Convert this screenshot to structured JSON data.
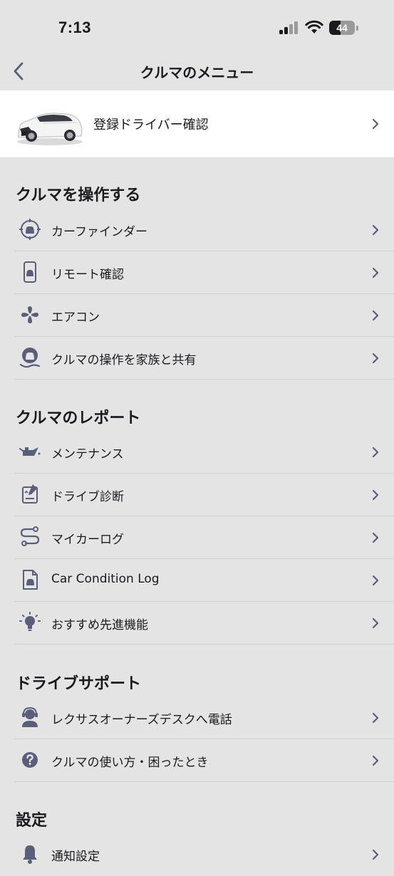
{
  "status_bar": {
    "time": "7:13",
    "battery_level": "44",
    "battery_fraction": 0.44
  },
  "nav": {
    "title": "クルマのメニュー"
  },
  "vehicle": {
    "label": "登録ドライバー確認"
  },
  "sections": {
    "operate": {
      "title": "クルマを操作する",
      "items": [
        {
          "label": "カーファインダー",
          "icon": "car-finder-icon"
        },
        {
          "label": "リモート確認",
          "icon": "remote-check-icon"
        },
        {
          "label": "エアコン",
          "icon": "fan-icon"
        },
        {
          "label": "クルマの操作を家族と共有",
          "icon": "share-car-icon"
        }
      ]
    },
    "report": {
      "title": "クルマのレポート",
      "items": [
        {
          "label": "メンテナンス",
          "icon": "oil-can-icon"
        },
        {
          "label": "ドライブ診断",
          "icon": "drive-diagnosis-icon"
        },
        {
          "label": "マイカーログ",
          "icon": "route-icon"
        },
        {
          "label": "Car Condition Log",
          "icon": "car-document-icon"
        },
        {
          "label": "おすすめ先進機能",
          "icon": "lightbulb-icon"
        }
      ]
    },
    "support": {
      "title": "ドライブサポート",
      "items": [
        {
          "label": "レクサスオーナーズデスクへ電話",
          "icon": "operator-icon"
        },
        {
          "label": "クルマの使い方・困ったとき",
          "icon": "help-icon"
        }
      ]
    },
    "settings": {
      "title": "設定",
      "items": [
        {
          "label": "通知設定",
          "icon": "bell-icon"
        }
      ]
    }
  },
  "colors": {
    "background": "#e4e4e4",
    "card": "#ffffff",
    "icon": "#5b5e7a",
    "chevron": "#5b5e7a",
    "divider": "#cfcfd3",
    "text": "#1b1b1f"
  }
}
